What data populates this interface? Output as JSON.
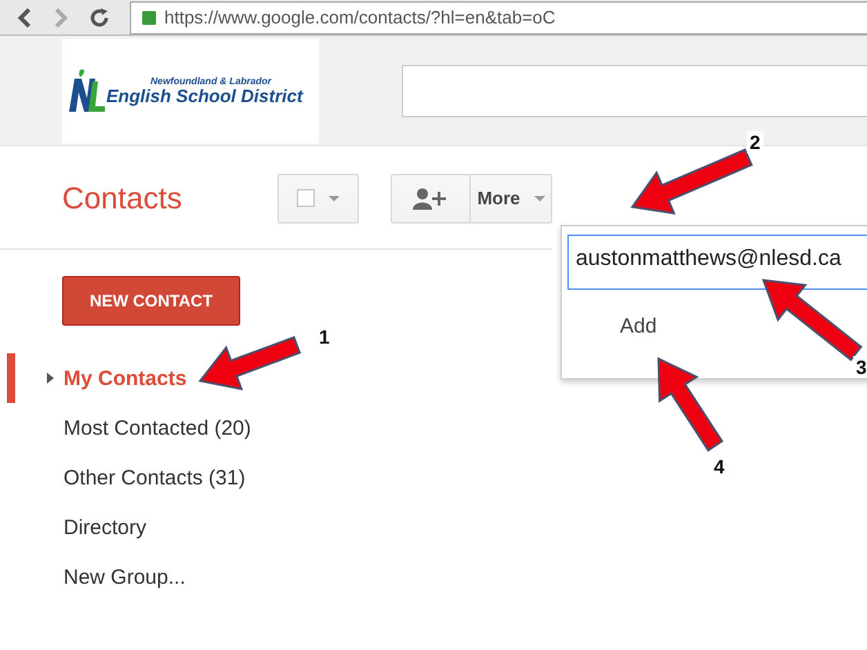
{
  "browser": {
    "url": "https://www.google.com/contacts/?hl=en&tab=oC"
  },
  "header": {
    "logo_small": "Newfoundland & Labrador",
    "logo_large": "English School District"
  },
  "title": "Contacts",
  "toolbar": {
    "select_checked": false,
    "more": "More"
  },
  "popup": {
    "value": "austonmatthews@nlesd.ca",
    "add": "Add"
  },
  "new_contact": "NEW CONTACT",
  "nav": [
    {
      "label": "My Contacts",
      "selected": true,
      "expandable": true
    },
    {
      "label": "Most Contacted (20)",
      "selected": false,
      "expandable": false
    },
    {
      "label": "Other Contacts (31)",
      "selected": false,
      "expandable": false
    },
    {
      "label": "Directory",
      "selected": false,
      "expandable": false
    },
    {
      "label": "New Group...",
      "selected": false,
      "expandable": false
    }
  ],
  "annotations": [
    {
      "label": "1"
    },
    {
      "label": "2"
    },
    {
      "label": "3"
    },
    {
      "label": "4"
    }
  ]
}
